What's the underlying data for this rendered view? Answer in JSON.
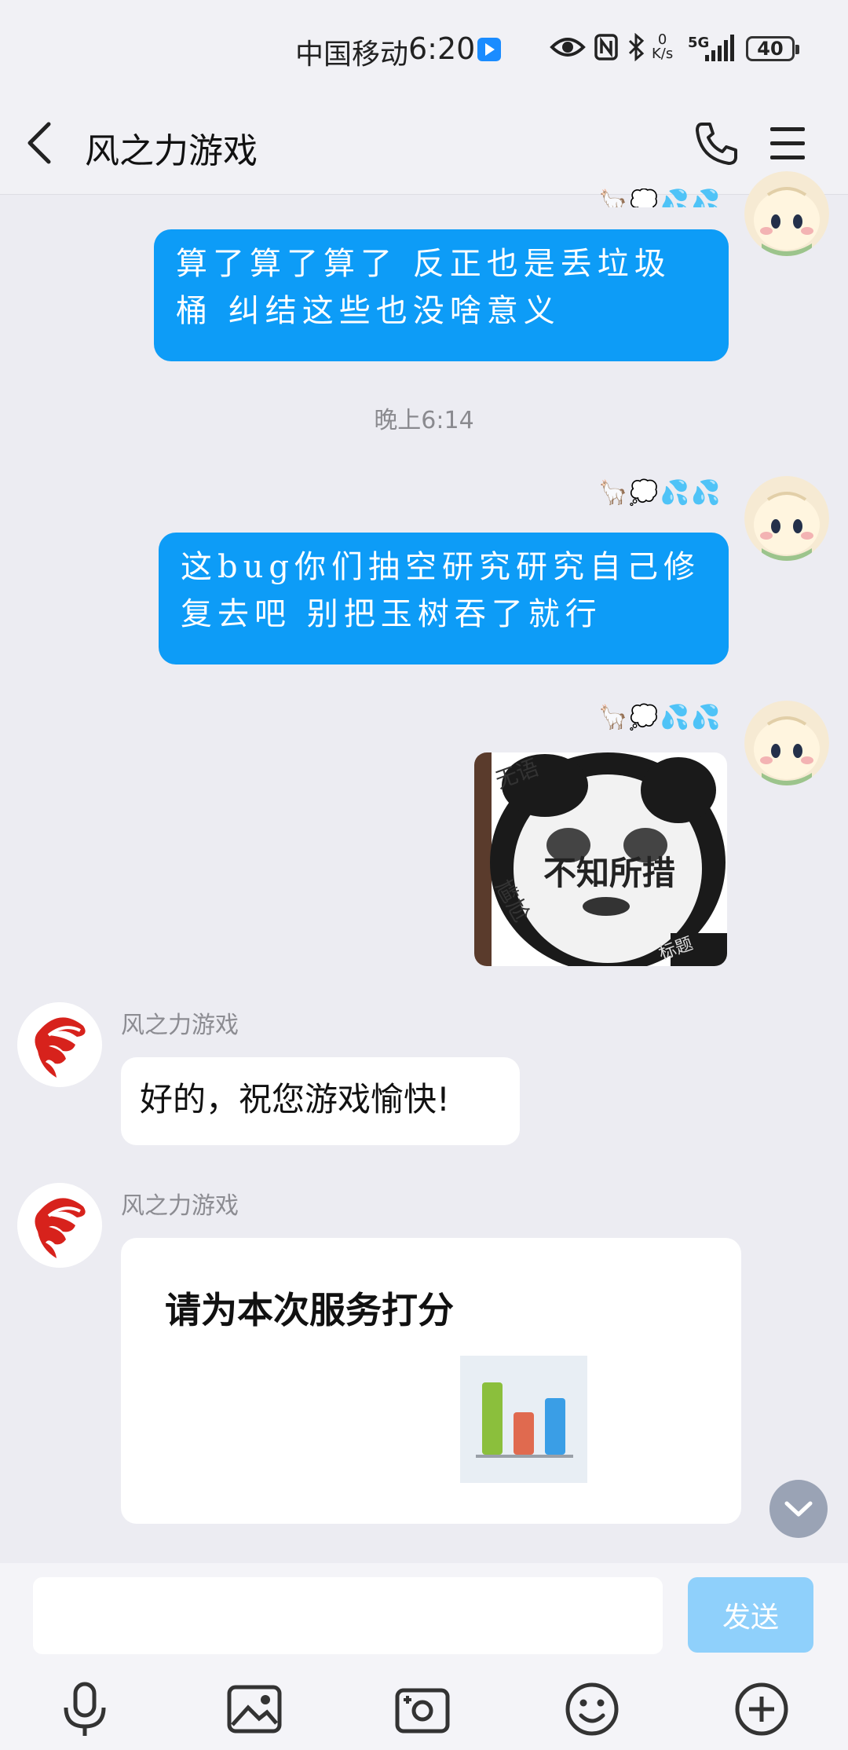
{
  "status_bar": {
    "carrier": "中国移动",
    "time": "6:20",
    "net_speed_value": "0",
    "net_speed_unit": "K/s",
    "network": "5G",
    "battery": "40"
  },
  "header": {
    "title": "风之力游戏"
  },
  "messages": {
    "msg1_text": "算了算了算了  反正也是丢垃圾桶  纠结这些也没啥意义",
    "timestamp": "晚上6:14",
    "msg2_text": "这bug你们抽空研究研究自己修复去吧  别把玉树吞了就行",
    "tags": "🦙💭💦💦",
    "sticker": {
      "main_text": "不知所措",
      "corner_top": "无语",
      "corner_left": "尴尬",
      "corner_bottom": "标题"
    },
    "bot_sender": "风之力游戏",
    "bot_reply": "好的，祝您游戏愉快!",
    "rating_card_title": "请为本次服务打分"
  },
  "input": {
    "placeholder": "",
    "send_label": "发送"
  },
  "colors": {
    "bubble_me": "#0d9cf7",
    "send_disabled": "#8fd0fb",
    "background": "#ececf2"
  }
}
